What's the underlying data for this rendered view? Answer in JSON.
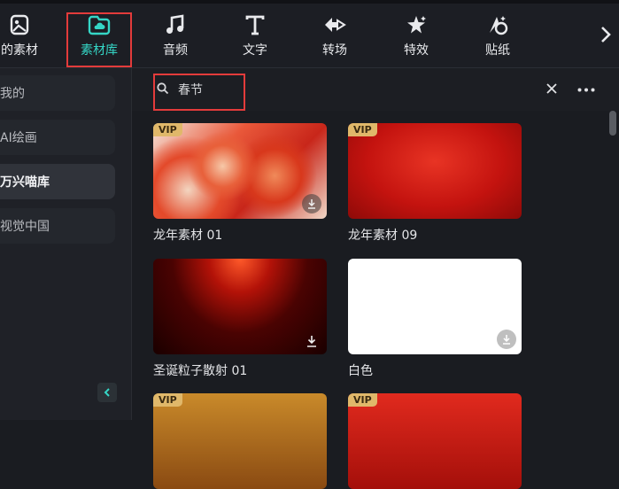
{
  "tabs": [
    {
      "label": "的素材",
      "icon": "my-assets-icon",
      "active": false
    },
    {
      "label": "素材库",
      "icon": "cloud-folder-icon",
      "active": true
    },
    {
      "label": "音频",
      "icon": "music-note-icon",
      "active": false
    },
    {
      "label": "文字",
      "icon": "text-icon",
      "active": false
    },
    {
      "label": "转场",
      "icon": "transition-icon",
      "active": false
    },
    {
      "label": "特效",
      "icon": "effects-icon",
      "active": false
    },
    {
      "label": "贴纸",
      "icon": "sticker-icon",
      "active": false
    }
  ],
  "sidebar": {
    "items": [
      {
        "label": "我的"
      },
      {
        "label": "AI绘画"
      },
      {
        "label": "万兴喵库"
      },
      {
        "label": "视觉中国"
      }
    ]
  },
  "search": {
    "value": "春节"
  },
  "cards": [
    {
      "label": "龙年素材 01",
      "vip": "VIP"
    },
    {
      "label": "龙年素材 09",
      "vip": "VIP"
    },
    {
      "label": "圣诞粒子散射 01",
      "vip": ""
    },
    {
      "label": "白色",
      "vip": ""
    },
    {
      "label": "",
      "vip": "VIP"
    },
    {
      "label": "",
      "vip": "VIP"
    }
  ],
  "colors": {
    "accent": "#35d6c6",
    "highlight": "#e33b3b",
    "vip": "#e0b86a"
  }
}
